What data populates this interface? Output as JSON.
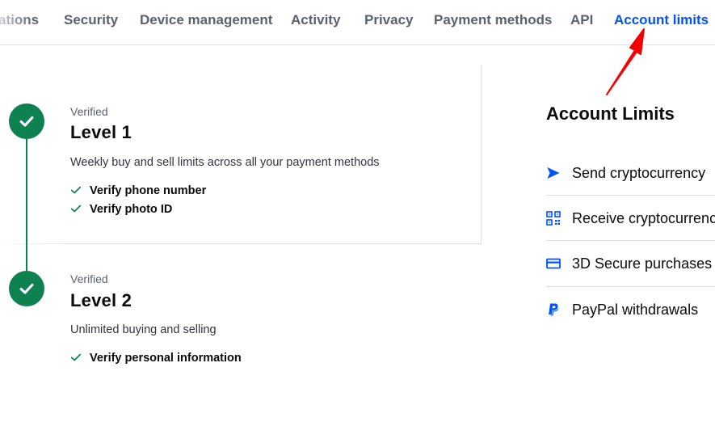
{
  "tabs": [
    {
      "label": "ations",
      "active": false
    },
    {
      "label": "Security",
      "active": false
    },
    {
      "label": "Device management",
      "active": false
    },
    {
      "label": "Activity",
      "active": false
    },
    {
      "label": "Privacy",
      "active": false
    },
    {
      "label": "Payment methods",
      "active": false
    },
    {
      "label": "API",
      "active": false
    },
    {
      "label": "Account limits",
      "active": true
    }
  ],
  "levels": [
    {
      "status": "Verified",
      "title": "Level 1",
      "description": "Weekly buy and sell limits across all your payment methods",
      "requirements": [
        "Verify phone number",
        "Verify photo ID"
      ]
    },
    {
      "status": "Verified",
      "title": "Level 2",
      "description": "Unlimited buying and selling",
      "requirements": [
        "Verify personal information"
      ]
    }
  ],
  "limits": {
    "title": "Account Limits",
    "items": [
      {
        "label": "Send cryptocurrency",
        "icon": "send-arrow-icon"
      },
      {
        "label": "Receive cryptocurrency",
        "icon": "qr-code-icon"
      },
      {
        "label": "3D Secure purchases",
        "icon": "credit-card-icon"
      },
      {
        "label": "PayPal withdrawals",
        "icon": "paypal-icon"
      }
    ]
  },
  "colors": {
    "accent": "#0052ff",
    "success": "#0e8151",
    "annotation_arrow": "#f40000",
    "muted_text": "#5b616e",
    "divider": "#dcdfe4"
  }
}
